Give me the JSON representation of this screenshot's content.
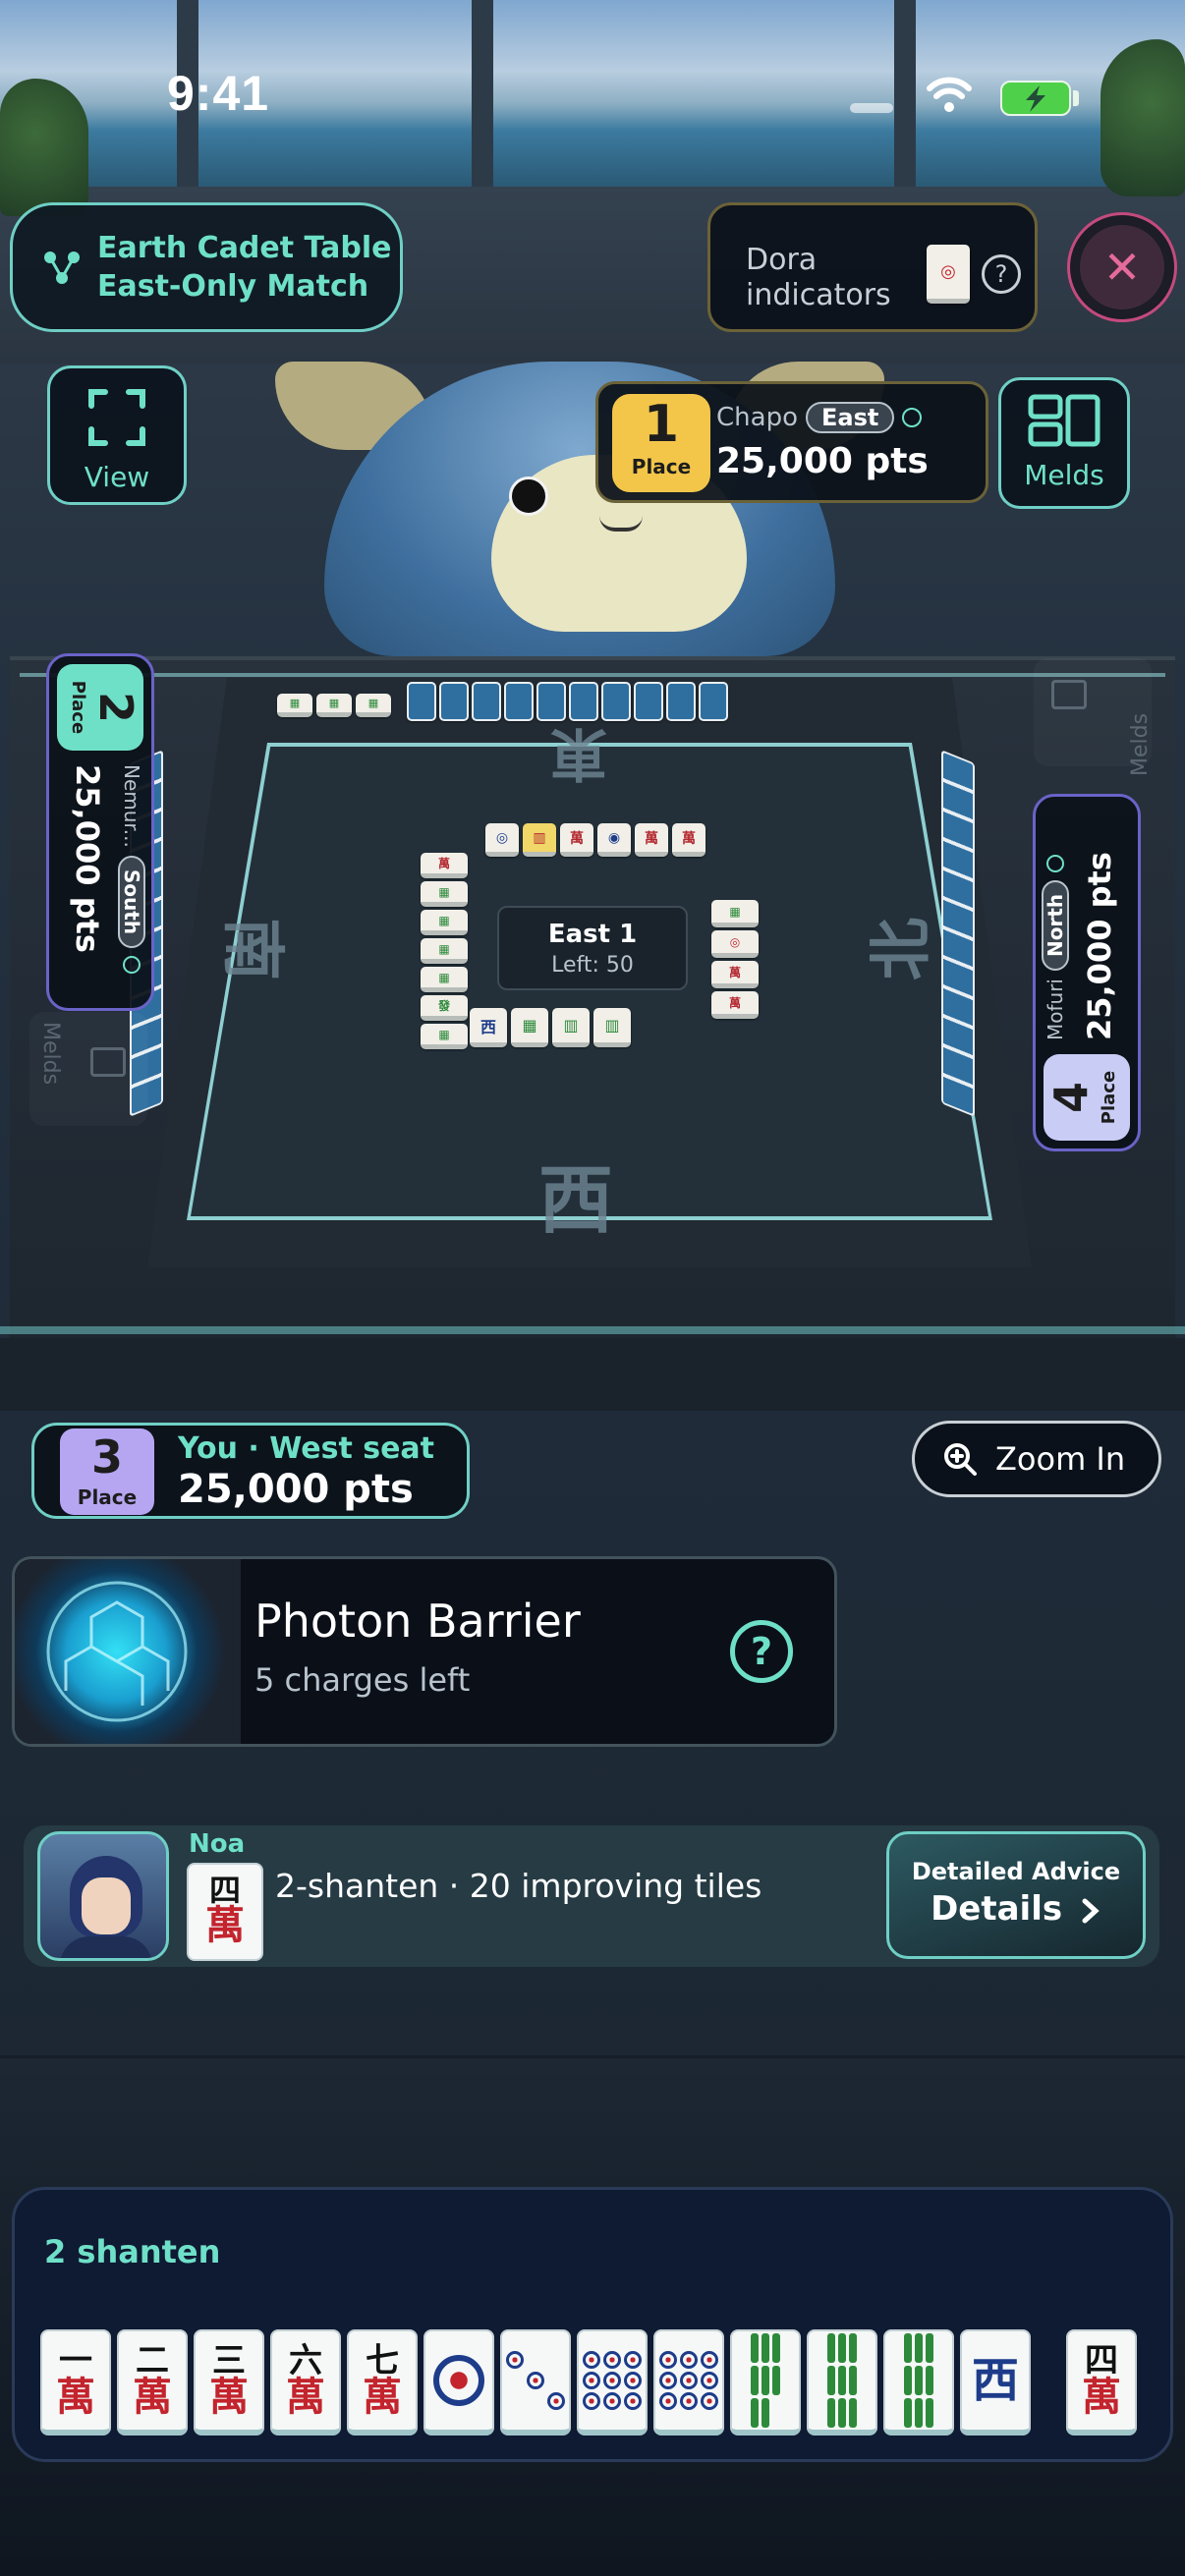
{
  "status_bar": {
    "time": "9:41"
  },
  "header": {
    "table_name_line1": "Earth Cadet Table",
    "table_name_line2": "East-Only Match",
    "dora": {
      "label_line1": "Dora",
      "label_line2": "indicators",
      "help": "?"
    },
    "close": "✕"
  },
  "controls": {
    "view_label": "View",
    "melds_label": "Melds",
    "zoom_label": "Zoom In"
  },
  "players": {
    "top": {
      "place": "1",
      "place_label": "Place",
      "name": "Chapo",
      "seat": "East",
      "points": "25,000 pts"
    },
    "left": {
      "place": "2",
      "place_label": "Place",
      "name": "Nemur...",
      "seat": "South",
      "points": "25,000 pts",
      "melds_label": "Melds"
    },
    "right": {
      "place": "4",
      "place_label": "Place",
      "name": "Mofuri",
      "seat": "North",
      "points": "25,000 pts",
      "melds_label": "Melds"
    },
    "you": {
      "place": "3",
      "place_label": "Place",
      "label": "You · West seat",
      "points": "25,000 pts"
    }
  },
  "table": {
    "round": "East 1",
    "tiles_left": "Left: 50",
    "winds": {
      "north_side": "東",
      "left_side": "南",
      "right_side": "北",
      "bottom_side": "西"
    }
  },
  "skill": {
    "name": "Photon Barrier",
    "charges": "5 charges left",
    "help": "?"
  },
  "advisor": {
    "name": "Noa",
    "tile_top": "四",
    "tile_bottom": "萬",
    "summary": "2-shanten · 20 improving tiles",
    "button_caption": "Detailed Advice",
    "button_label": "Details",
    "button_icon": "chevron-right-icon"
  },
  "hand": {
    "title": "2 shanten",
    "tiles": [
      {
        "type": "man",
        "top": "一",
        "bottom": "萬"
      },
      {
        "type": "man",
        "top": "二",
        "bottom": "萬"
      },
      {
        "type": "man",
        "top": "三",
        "bottom": "萬"
      },
      {
        "type": "man",
        "top": "六",
        "bottom": "萬"
      },
      {
        "type": "man",
        "top": "七",
        "bottom": "萬"
      },
      {
        "type": "pin",
        "count": 1
      },
      {
        "type": "pin",
        "count": 3
      },
      {
        "type": "pin",
        "count": 9
      },
      {
        "type": "pin",
        "count": 9
      },
      {
        "type": "sou",
        "count": 8
      },
      {
        "type": "sou",
        "count": 9
      },
      {
        "type": "sou",
        "count": 9
      },
      {
        "type": "wind",
        "top": "西"
      }
    ],
    "drawn_tile": {
      "type": "man",
      "top": "四",
      "bottom": "萬"
    }
  },
  "colors": {
    "accent": "#6fe0c8",
    "place1": "#f3c64a",
    "place2": "#6fe0c8",
    "place3": "#b6a6f2",
    "place4": "#c9cdf5",
    "close": "#e56b9b"
  }
}
